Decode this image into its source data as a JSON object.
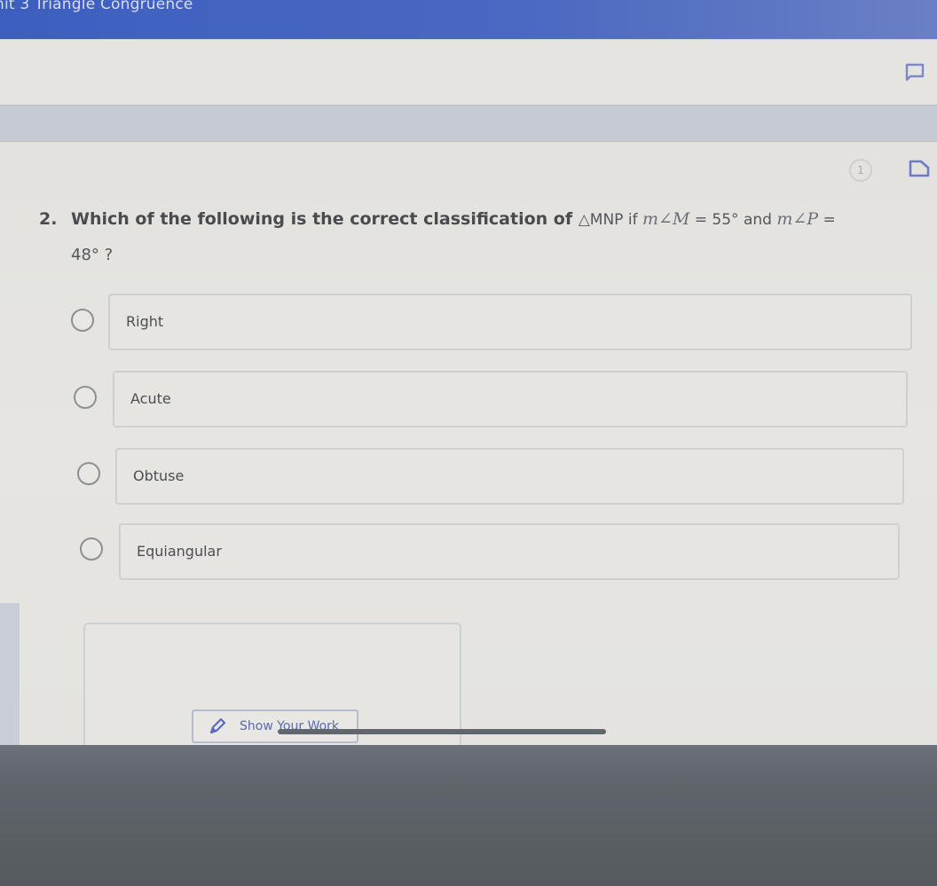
{
  "header": {
    "title": "nit 3 Triangle Congruence"
  },
  "toolbar": {
    "comment_icon": "comment-icon"
  },
  "question": {
    "number": "2.",
    "text_bold": "Which of the following is the correct classification of ",
    "triangle": "△MNP",
    "if_word": " if ",
    "angle_m": "m∠M",
    "equals_55": " = 55°",
    "and_word": " and ",
    "angle_p": "m∠P",
    "equals": " =",
    "line2": "48° ?",
    "hint_label": "1",
    "hint_icon": "hint-icon",
    "bookmark_icon": "bookmark-icon"
  },
  "options": [
    {
      "label": "Right",
      "selected": false
    },
    {
      "label": "Acute",
      "selected": false
    },
    {
      "label": "Obtuse",
      "selected": false
    },
    {
      "label": "Equiangular",
      "selected": false
    }
  ],
  "work": {
    "button_label": "Show Your Work",
    "icon": "pencil-icon"
  },
  "colors": {
    "header_blue": "#3c5fbf",
    "accent_text": "#5a6ab0",
    "text": "#4a4b4f"
  }
}
